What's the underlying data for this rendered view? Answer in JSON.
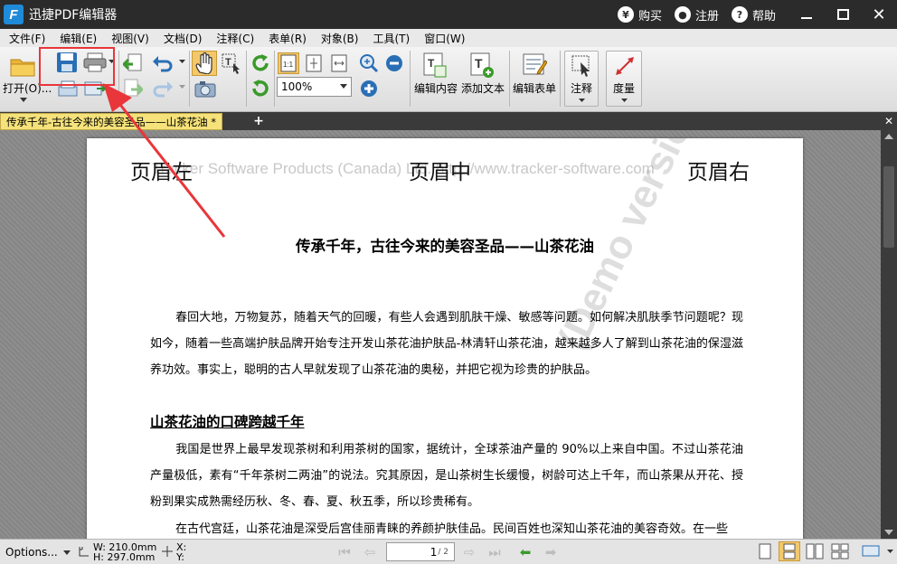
{
  "app": {
    "title": "迅捷PDF编辑器",
    "logo_letter": "F",
    "buy_label": "购买",
    "register_label": "注册",
    "help_label": "帮助"
  },
  "menu": [
    "文件(F)",
    "编辑(E)",
    "视图(V)",
    "文档(D)",
    "注释(C)",
    "表单(R)",
    "对象(B)",
    "工具(T)",
    "窗口(W)"
  ],
  "toolbar": {
    "open_label": "打开(O)...",
    "zoom_value": "100%",
    "edit_content_label": "编辑内容",
    "add_text_label": "添加文本",
    "edit_form_label": "编辑表单",
    "annotate_label": "注释",
    "measure_label": "度量"
  },
  "tab": {
    "label": "传承千年-古往今来的美容圣品——山茶花油 *"
  },
  "document": {
    "header_left": "页眉左",
    "header_mid": "页眉中",
    "header_right": "页眉右",
    "header_watermark": "Tracker Software Products (Canada) Ltd. http://www.tracker-software.com",
    "diagonal_watermark": "(Demo version)",
    "title": "传承千年，古往今来的美容圣品——山茶花油",
    "para1": "春回大地，万物复苏，随着天气的回暖，有些人会遇到肌肤干燥、敏感等问题。如何解决肌肤季节问题呢？现如今，随着一些高端护肤品牌开始专注开发山茶花油护肤品-林清轩山茶花油，越来越多人了解到山茶花油的保湿滋养功效。事实上，聪明的古人早就发现了山茶花油的奥秘，并把它视为珍贵的护肤品。",
    "section_heading": "山茶花油的口碑跨越千年",
    "para2": "我国是世界上最早发现茶树和利用茶树的国家，据统计，全球茶油产量的 90%以上来自中国。不过山茶花油产量极低，素有“千年茶树二两油”的说法。究其原因，是山茶树生长缓慢，树龄可达上千年，而山茶果从开花、授粉到果实成熟需经历秋、冬、春、夏、秋五季，所以珍贵稀有。",
    "para3": "在古代宫廷，山茶花油是深受后宫佳丽青睐的养颜护肤佳品。民间百姓也深知山茶花油的美容奇效。在一些"
  },
  "status": {
    "options_label": "Options...",
    "width_label": "W: 210.0mm",
    "height_label": "H: 297.0mm",
    "x_label": "X:",
    "y_label": "Y:",
    "current_page": "1",
    "total_pages": "/ 2"
  },
  "colors": {
    "annotation_red": "#e8363b",
    "tab_yellow": "#f5e27a",
    "titlebar": "#2b2b2b"
  }
}
